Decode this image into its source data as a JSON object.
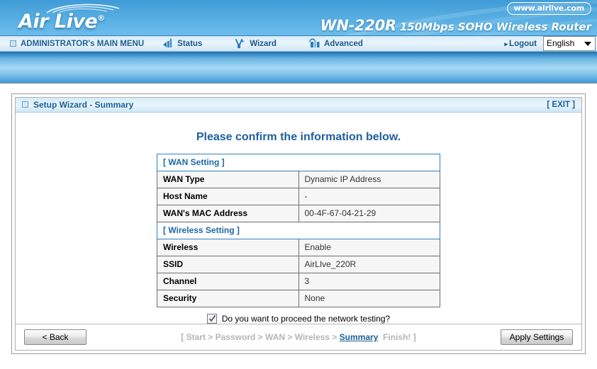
{
  "header": {
    "brand": "Air Live",
    "brand_reg": "®",
    "model": "WN-220R",
    "model_desc": "150Mbps SOHO Wireless Router",
    "website": "www.airlive.com"
  },
  "nav": {
    "main_menu": "ADMINISTRATOR's MAIN MENU",
    "items": [
      {
        "label": "Status",
        "icon": "status-icon"
      },
      {
        "label": "Wizard",
        "icon": "wizard-icon"
      },
      {
        "label": "Advanced",
        "icon": "advanced-icon"
      }
    ],
    "logout": "Logout",
    "logout_arrow": "▸",
    "language": "English"
  },
  "panel": {
    "title": "Setup Wizard - Summary",
    "exit": "[ EXIT ]",
    "confirm_heading": "Please confirm the information below."
  },
  "summary": {
    "sections": [
      {
        "heading": "[ WAN Setting ]",
        "rows": [
          {
            "label": "WAN Type",
            "value": "Dynamic IP Address"
          },
          {
            "label": "Host Name",
            "value": "-"
          },
          {
            "label": "WAN's MAC Address",
            "value": "00-4F-67-04-21-29"
          }
        ]
      },
      {
        "heading": "[ Wireless Setting ]",
        "rows": [
          {
            "label": "Wireless",
            "value": "Enable"
          },
          {
            "label": "SSID",
            "value": "AirLIve_220R"
          },
          {
            "label": "Channel",
            "value": "3"
          },
          {
            "label": "Security",
            "value": "None"
          }
        ]
      }
    ]
  },
  "network_test": {
    "checked": true,
    "label": "Do you want to proceed the network testing?"
  },
  "footer": {
    "back_button": "< Back",
    "apply_button": "Apply Settings",
    "steps_prefix": "[ ",
    "steps": [
      "Start",
      "Password",
      "WAN",
      "Wireless"
    ],
    "steps_separator": " > ",
    "current_step": "Summary",
    "steps_finish": "Finish! ]"
  },
  "colors": {
    "banner_blue": "#4fa6dd",
    "nav_text": "#16558c",
    "accent": "#1e5fa0",
    "section_border": "#2f82c0",
    "row_bg": "#f6f6f6"
  }
}
